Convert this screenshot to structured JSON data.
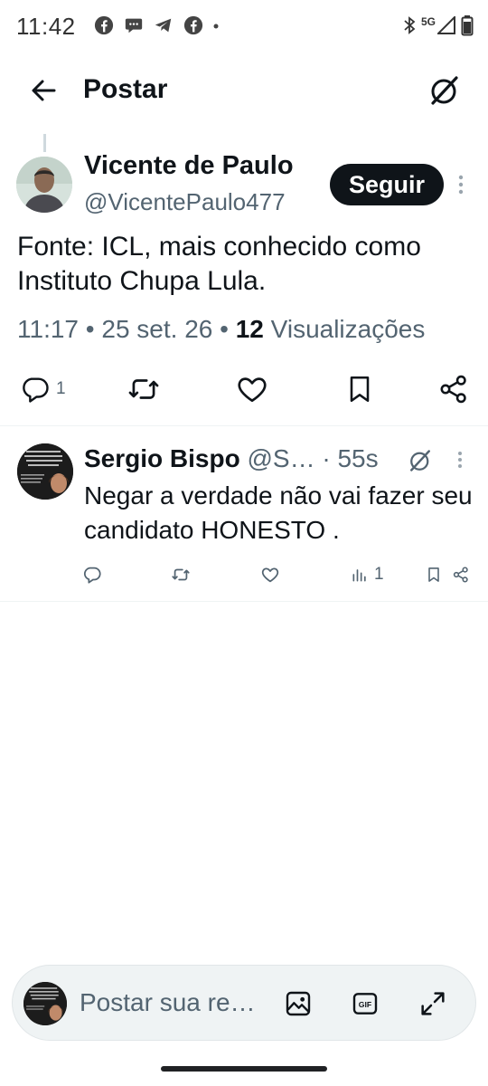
{
  "status_bar": {
    "time": "11:42",
    "network": "5G",
    "notification_icons": [
      "facebook-icon",
      "chat-bubble-icon",
      "telegram-icon",
      "facebook-icon"
    ],
    "system_icons": [
      "bluetooth-icon",
      "signal-icon",
      "battery-icon"
    ]
  },
  "header": {
    "title": "Postar",
    "back_icon": "arrow-left-icon",
    "grok_icon": "grok-icon"
  },
  "tweet": {
    "author_name": "Vicente de Paulo",
    "author_handle": "@VicentePaulo477",
    "follow_label": "Seguir",
    "text": "Fonte: ICL, mais conhecido como Instituto Chupa Lula.",
    "time": "11:17",
    "date": "25 set. 26",
    "views_count": "12",
    "views_label": "Visualizações",
    "reply_count": "1",
    "actions": [
      "reply-icon",
      "retweet-icon",
      "like-icon",
      "bookmark-icon",
      "share-icon"
    ]
  },
  "reply": {
    "author_name": "Sergio Bispo",
    "author_handle": "@S…",
    "time": "· 55s",
    "text": "Negar a verdade não vai fazer seu  candidato HONESTO .",
    "views_count": "1"
  },
  "composer": {
    "placeholder": "Postar sua re…",
    "icons": [
      "image-icon",
      "gif-icon",
      "expand-icon"
    ]
  },
  "colors": {
    "text_primary": "#0f1419",
    "text_secondary": "#536471",
    "follow_bg": "#0f1419",
    "divider": "#eff3f4",
    "composer_bg": "#eff3f4"
  }
}
